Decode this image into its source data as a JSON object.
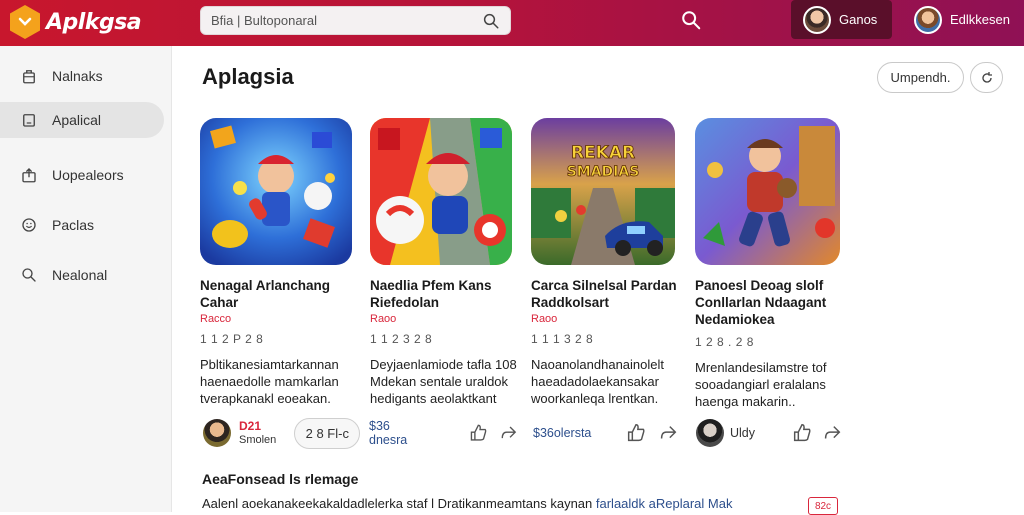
{
  "app": {
    "name": "Aplkgsa",
    "search_value": "Bfia | Bultoponaral",
    "search_placeholder": "Bfia | Bultoponaral",
    "accent": "#c8172d"
  },
  "header": {
    "users": [
      {
        "name": "Ganos",
        "active": true
      },
      {
        "name": "Edlkkesen",
        "active": false
      }
    ]
  },
  "sidebar": {
    "items": [
      {
        "label": "Nalnaks",
        "icon": "bag-icon"
      },
      {
        "label": "Apalical",
        "icon": "folder-icon",
        "active": true
      },
      {
        "label": "Uopealeors",
        "icon": "upload-icon"
      },
      {
        "label": "Paclas",
        "icon": "smile-icon"
      },
      {
        "label": "Nealonal",
        "icon": "search-icon"
      }
    ]
  },
  "main": {
    "title": "Aplagsia",
    "upgrade_button": "Umpendh.",
    "cards": [
      {
        "title": "Nenagal Arlanchang Cahar",
        "developer": "Racco",
        "meta": "1 1 2 P   2 8",
        "description": "Pbltikanesiamtarkannan haenaedolle mamkarlan tverapkanakl eoeakan.",
        "action_price": "D21",
        "action_sub": "Smolen",
        "action_pill": "2 8  Fl-c"
      },
      {
        "title": "Naedlia Pfem Kans Riefedolan",
        "developer": "Raoo",
        "meta": "1 1 2 3   2 8",
        "description": "Deyjaenlamiode tafla 108 Mdekan sentale uraldok hedigants aeolaktkant",
        "action_price": "$36 dnesra"
      },
      {
        "title": "Carca Silnelsal Pardan Raddkolsart",
        "developer": "Raoo",
        "meta": "1 1 1 3   2 8",
        "description": "Naoanolandhanainolelt haeadadolaekansakar woorkanleqa lrentkan.",
        "action_price": "$36olersta",
        "thumb_title": [
          "REKAR",
          "SMADIAS"
        ]
      },
      {
        "title": "Panoesl Deoag slolf Conllarlan Ndaagant Nedamiokea",
        "developer": "",
        "meta": "1 2 8 .   2 8",
        "description": "Mrenlandesilamstre tof sooadangiarl eralalans haenga makarin..",
        "action_price": "Uldy"
      }
    ],
    "section_title": "AeaFonsead ls rlemage",
    "bottom_text": "Aalenl aoekanakeekakaldadlelerka staf",
    "bottom_text_mid": "l Dratikanmeamtans kaynan",
    "bottom_text_link": "farlaaldk aReplaral Mak",
    "bottom_badge": "82c"
  }
}
